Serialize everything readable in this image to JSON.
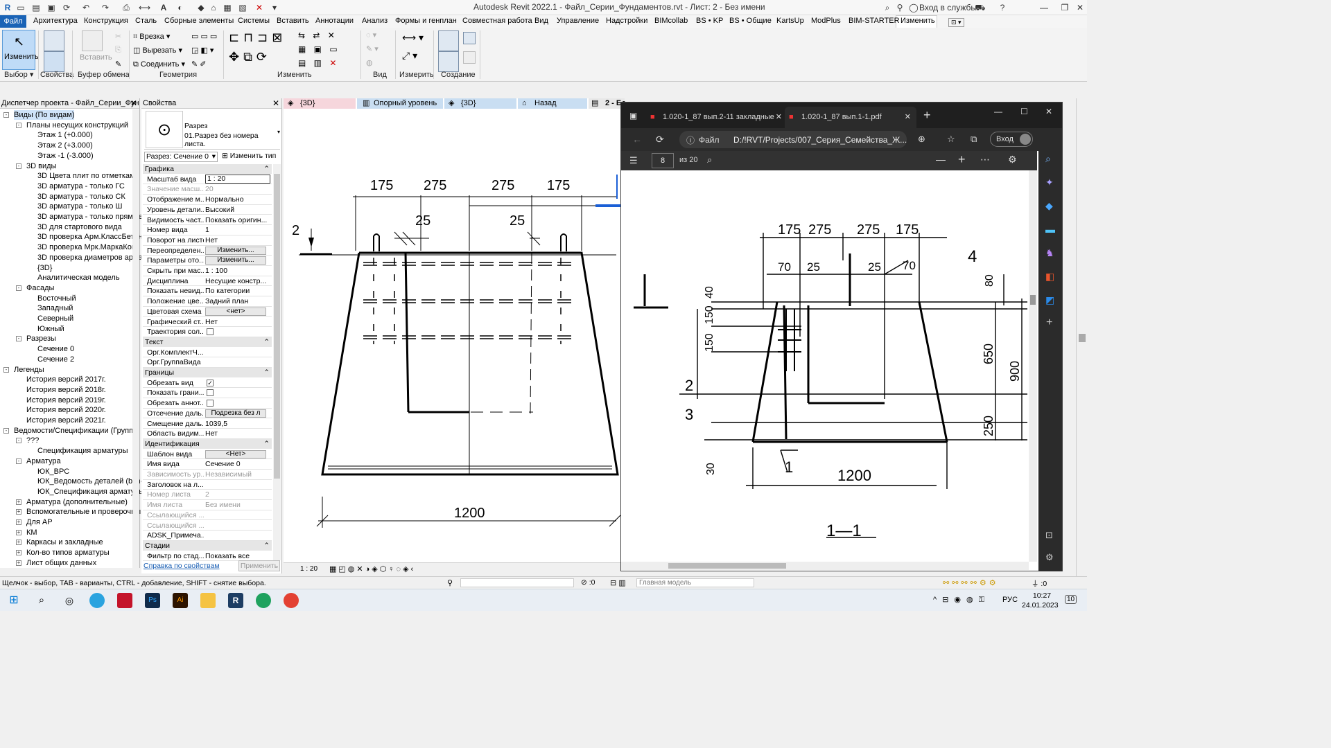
{
  "window": {
    "title": "Autodesk Revit 2022.1 - Файл_Серии_Фундаментов.rvt - Лист: 2 - Без имени",
    "signin": "Вход в службы"
  },
  "ribbon_tabs": [
    "Файл",
    "Архитектура",
    "Конструкция",
    "Сталь",
    "Сборные элементы",
    "Системы",
    "Вставить",
    "Аннотации",
    "Анализ",
    "Формы и генплан",
    "Совместная работа",
    "Вид",
    "Управление",
    "Надстройки",
    "BIMcollab",
    "BS • KP",
    "BS • Общие",
    "KartsUp",
    "ModPlus",
    "BIM-STARTER",
    "Изменить"
  ],
  "ribbon": {
    "modify_label": "Изменить",
    "panels": {
      "select": "Выбор",
      "properties": "Свойства",
      "clipboard": "Буфер обмена",
      "geometry": "Геометрия",
      "modify": "Изменить",
      "view": "Вид",
      "measure": "Измерить",
      "create": "Создание"
    },
    "paste_label": "Вставить",
    "geometry_items": [
      "Врезка",
      "Вырезать",
      "Соединить"
    ]
  },
  "project_browser": {
    "title": "Диспетчер проекта - Файл_Серии_Фун...",
    "items": [
      {
        "t": "Виды (По видам)",
        "lvl": 0,
        "tog": "-",
        "hl": true
      },
      {
        "t": "Планы несущих конструкций",
        "lvl": 1,
        "tog": "-"
      },
      {
        "t": "Этаж 1 (+0.000)",
        "lvl": 2
      },
      {
        "t": "Этаж 2 (+3.000)",
        "lvl": 2
      },
      {
        "t": "Этаж -1 (-3.000)",
        "lvl": 2
      },
      {
        "t": "3D виды",
        "lvl": 1,
        "tog": "-"
      },
      {
        "t": "3D Цвета плит по отметкам",
        "lvl": 2
      },
      {
        "t": "3D арматура - только ГС",
        "lvl": 2
      },
      {
        "t": "3D арматура - только СК",
        "lvl": 2
      },
      {
        "t": "3D арматура - только Ш",
        "lvl": 2
      },
      {
        "t": "3D арматура - только прямые",
        "lvl": 2
      },
      {
        "t": "3D для стартового вида",
        "lvl": 2
      },
      {
        "t": "3D проверка Арм.КлассБетон",
        "lvl": 2
      },
      {
        "t": "3D проверка Мрк.МаркаКонс",
        "lvl": 2
      },
      {
        "t": "3D проверка диаметров арма",
        "lvl": 2
      },
      {
        "t": "{3D}",
        "lvl": 2
      },
      {
        "t": "Аналитическая модель",
        "lvl": 2
      },
      {
        "t": "Фасады",
        "lvl": 1,
        "tog": "-"
      },
      {
        "t": "Восточный",
        "lvl": 2
      },
      {
        "t": "Западный",
        "lvl": 2
      },
      {
        "t": "Северный",
        "lvl": 2
      },
      {
        "t": "Южный",
        "lvl": 2
      },
      {
        "t": "Разрезы",
        "lvl": 1,
        "tog": "-"
      },
      {
        "t": "Сечение 0",
        "lvl": 2
      },
      {
        "t": "Сечение 2",
        "lvl": 2
      },
      {
        "t": "Легенды",
        "lvl": 0,
        "tog": "-"
      },
      {
        "t": "История версий 2017г.",
        "lvl": 1
      },
      {
        "t": "История версий 2018г.",
        "lvl": 1
      },
      {
        "t": "История версий 2019г.",
        "lvl": 1
      },
      {
        "t": "История версий 2020г.",
        "lvl": 1
      },
      {
        "t": "История версий 2021г.",
        "lvl": 1
      },
      {
        "t": "Ведомости/Спецификации (Групп",
        "lvl": 0,
        "tog": "-"
      },
      {
        "t": "???",
        "lvl": 1,
        "tog": "-"
      },
      {
        "t": "Спецификация арматуры",
        "lvl": 2
      },
      {
        "t": "Арматура",
        "lvl": 1,
        "tog": "-"
      },
      {
        "t": "ЮК_ВРС",
        "lvl": 2
      },
      {
        "t": "ЮК_Ведомость деталей (bim-s",
        "lvl": 2
      },
      {
        "t": "ЮК_Спецификация арматуры",
        "lvl": 2
      },
      {
        "t": "Арматура (дополнительные)",
        "lvl": 1,
        "tog": "+"
      },
      {
        "t": "Вспомогательные и проверочны",
        "lvl": 1,
        "tog": "+"
      },
      {
        "t": "Для АР",
        "lvl": 1,
        "tog": "+"
      },
      {
        "t": "КМ",
        "lvl": 1,
        "tog": "+"
      },
      {
        "t": "Каркасы и закладные",
        "lvl": 1,
        "tog": "+"
      },
      {
        "t": "Кол-во типов арматуры",
        "lvl": 1,
        "tog": "+"
      },
      {
        "t": "Лист общих данных",
        "lvl": 1,
        "tog": "+"
      }
    ]
  },
  "properties": {
    "title": "Свойства",
    "type_family": "Разрез",
    "type_name": "01.Разрез без номера листа.",
    "selector": "Разрез: Сечение 0",
    "edit_type": "Изменить тип",
    "sections": [
      {
        "name": "Графика",
        "rows": [
          {
            "k": "Масштаб вида",
            "v": "1 : 20",
            "box": true
          },
          {
            "k": "Значение масш...",
            "v": "20",
            "grey": true
          },
          {
            "k": "Отображение м...",
            "v": "Нормально"
          },
          {
            "k": "Уровень детали...",
            "v": "Высокий"
          },
          {
            "k": "Видимость част...",
            "v": "Показать оригин..."
          },
          {
            "k": "Номер вида",
            "v": "1"
          },
          {
            "k": "Поворот на листе",
            "v": "Нет"
          },
          {
            "k": "Переопределен...",
            "v": "Изменить...",
            "btn": true
          },
          {
            "k": "Параметры ото...",
            "v": "Изменить...",
            "btn": true
          },
          {
            "k": "Скрыть при мас...",
            "v": "1 : 100"
          },
          {
            "k": "Дисциплина",
            "v": "Несущие констр..."
          },
          {
            "k": "Показать невид...",
            "v": "По категории"
          },
          {
            "k": "Положение цве...",
            "v": "Задний план"
          },
          {
            "k": "Цветовая схема",
            "v": "<нет>",
            "btn": true
          },
          {
            "k": "Графический ст...",
            "v": "Нет"
          },
          {
            "k": "Траектория сол...",
            "v": "",
            "chk": false
          }
        ]
      },
      {
        "name": "Текст",
        "rows": [
          {
            "k": "Орг.КомплектЧ...",
            "v": ""
          },
          {
            "k": "Орг.ГруппаВида",
            "v": ""
          }
        ]
      },
      {
        "name": "Границы",
        "rows": [
          {
            "k": "Обрезать вид",
            "v": "",
            "chk": true
          },
          {
            "k": "Показать грани...",
            "v": "",
            "chk": false
          },
          {
            "k": "Обрезать аннот...",
            "v": "",
            "chk": false
          },
          {
            "k": "Отсечение даль...",
            "v": "Подрезка без л",
            "btn": true
          },
          {
            "k": "Смещение даль...",
            "v": "1039,5"
          },
          {
            "k": "Область видим...",
            "v": "Нет"
          }
        ]
      },
      {
        "name": "Идентификация",
        "rows": [
          {
            "k": "Шаблон вида",
            "v": "<Нет>",
            "btn": true
          },
          {
            "k": "Имя вида",
            "v": "Сечение 0"
          },
          {
            "k": "Зависимость ур...",
            "v": "Независимый",
            "grey": true
          },
          {
            "k": "Заголовок на л...",
            "v": ""
          },
          {
            "k": "Номер листа",
            "v": "2",
            "grey": true
          },
          {
            "k": "Имя листа",
            "v": "Без имени",
            "grey": true
          },
          {
            "k": "Ссылающийся ...",
            "v": "",
            "grey": true
          },
          {
            "k": "Ссылающийся ...",
            "v": "",
            "grey": true
          },
          {
            "k": "ADSK_Примеча...",
            "v": ""
          }
        ]
      },
      {
        "name": "Стадии",
        "rows": [
          {
            "k": "Фильтр по стад...",
            "v": "Показать все"
          }
        ]
      }
    ],
    "help_link": "Справка по свойствам",
    "apply": "Применить"
  },
  "view_tabs": [
    "{3D}",
    "Опорный уровень",
    "{3D}",
    "Назад",
    "2 - Бе"
  ],
  "drawing": {
    "dims": [
      "175",
      "275",
      "275",
      "175",
      "25",
      "25",
      "1200"
    ],
    "section_mark": "2",
    "scale": "1 : 20"
  },
  "edge": {
    "tabs": [
      "1.020-1_87 вып.2-11 закладные",
      "1.020-1_87 вып.1-1.pdf"
    ],
    "file_label": "Файл",
    "address": "D:/!RVT/Projects/007_Серия_Семейства_Ж...",
    "login": "Вход",
    "page": "8",
    "page_of": "из 20",
    "pdf_dims": [
      "175",
      "275",
      "275",
      "175",
      "70",
      "25",
      "25",
      "70",
      "4",
      "40",
      "150",
      "150",
      "650",
      "900",
      "250",
      "80",
      "30",
      "2",
      "3",
      "1",
      "1200",
      "1—1"
    ]
  },
  "status": {
    "hint": "Щелчок - выбор, TAB - варианты, CTRL - добавление, SHIFT - снятие выбора.",
    "filter_count": ":0",
    "model": "Главная модель",
    "sel_count": ":0"
  },
  "taskbar": {
    "lang": "РУС",
    "time": "10:27",
    "date": "24.01.2023",
    "notif": "10"
  }
}
